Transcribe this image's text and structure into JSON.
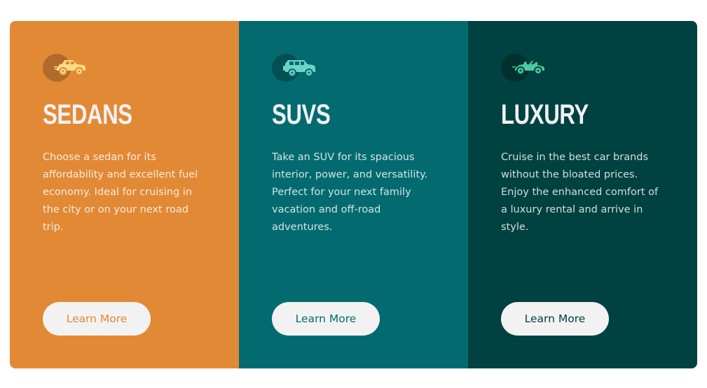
{
  "cards": [
    {
      "title": "SEDANS",
      "description": "Choose a sedan for its affordability and excellent fuel economy. Ideal for cruising in the city or on your next road trip.",
      "button_label": "Learn More",
      "icon": "sedan-car-icon",
      "color": "#e28936"
    },
    {
      "title": "SUVS",
      "description": "Take an SUV for its spacious interior, power, and versatility. Perfect for your next family vacation and off-road adventures.",
      "button_label": "Learn More",
      "icon": "suv-car-icon",
      "color": "#036b6f"
    },
    {
      "title": "LUXURY",
      "description": "Cruise in the best car brands without the bloated prices. Enjoy the enhanced comfort of a luxury rental and arrive in style.",
      "button_label": "Learn More",
      "icon": "luxury-car-icon",
      "color": "#004141"
    }
  ],
  "colors": {
    "button_bg": "#f2f2f2",
    "title_text": "#f2f2f2"
  }
}
